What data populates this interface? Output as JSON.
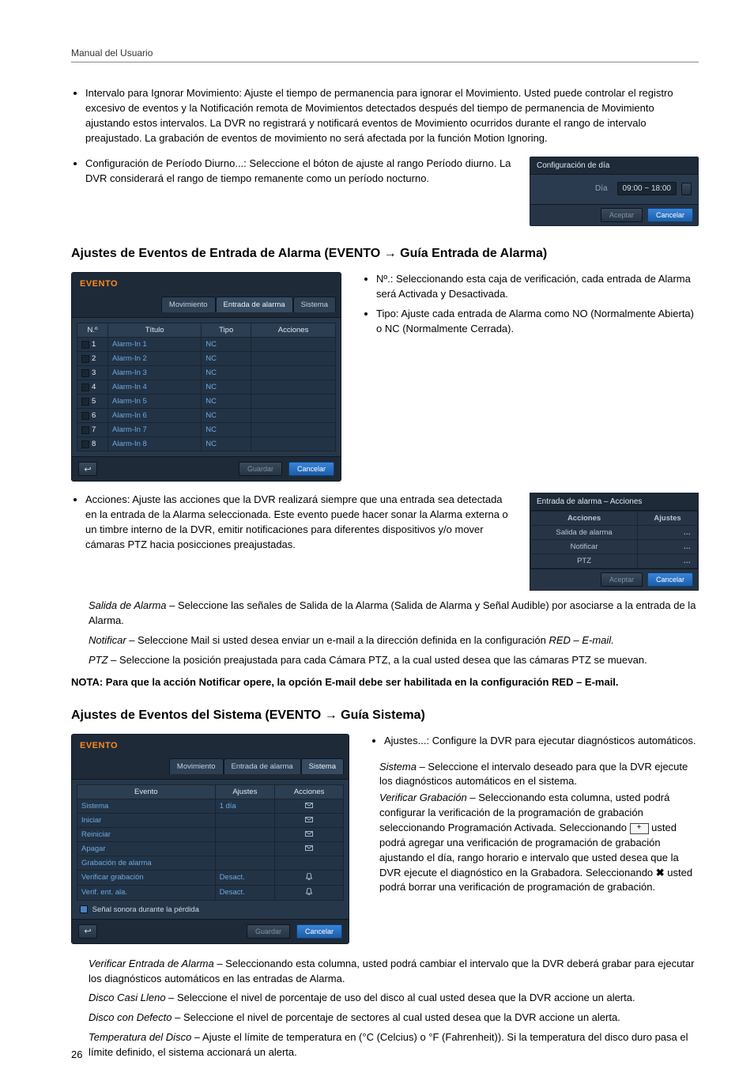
{
  "header": {
    "title": "Manual del Usuario"
  },
  "page_number": "26",
  "bullets_top": [
    "Intervalo para Ignorar Movimiento: Ajuste el tiempo de permanencia para ignorar el Movimiento. Usted puede controlar el registro excesivo de eventos y la Notificación remota de Movimientos detectados después del tiempo de permanencia de Movimiento ajustando estos intervalos. La DVR no registrará y notificará eventos de Movimiento ocurridos durante el rango de intervalo preajustado. La grabación de eventos de movimiento no será afectada por la función Motion Ignoring.",
    "Configuración de Período Diurno...: Seleccione el bóton de ajuste al rango Período diurno. La DVR considerará el rango de tiempo remanente como un período nocturno."
  ],
  "day_panel": {
    "title": "Configuración de día",
    "label": "Día",
    "time": "09:00 ~ 18:00",
    "accept": "Aceptar",
    "cancel": "Cancelar"
  },
  "sec1": {
    "heading": "Ajustes de Eventos de Entrada de Alarma (EVENTO → Guía Entrada de Alarma)",
    "side_bullets": [
      "Nº.: Seleccionando esta caja de verificación, cada entrada de Alarma será Activada y Desactivada.",
      "Tipo: Ajuste cada entrada de Alarma como NO (Normalmente Abierta) o NC (Normalmente Cerrada)."
    ],
    "ui": {
      "brand": "EVENTO",
      "tabs": [
        "Movimiento",
        "Entrada de alarma",
        "Sistema"
      ],
      "active_tab_index": 1,
      "cols": [
        "N.º",
        "Título",
        "Tipo",
        "Acciones"
      ],
      "rows": [
        {
          "n": "1",
          "title": "Alarm-In 1",
          "type": "NC"
        },
        {
          "n": "2",
          "title": "Alarm-In 2",
          "type": "NC"
        },
        {
          "n": "3",
          "title": "Alarm-In 3",
          "type": "NC"
        },
        {
          "n": "4",
          "title": "Alarm-In 4",
          "type": "NC"
        },
        {
          "n": "5",
          "title": "Alarm-In 5",
          "type": "NC"
        },
        {
          "n": "6",
          "title": "Alarm-In 6",
          "type": "NC"
        },
        {
          "n": "7",
          "title": "Alarm-In 7",
          "type": "NC"
        },
        {
          "n": "8",
          "title": "Alarm-In 8",
          "type": "NC"
        }
      ],
      "save": "Guardar",
      "cancel": "Cancelar"
    }
  },
  "acciones_text": "Acciones: Ajuste las acciones que la DVR realizará siempre que una entrada sea detectada en la entrada de la Alarma seleccionada. Este evento puede hacer sonar la Alarma externa o un timbre interno de la DVR, emitir notificaciones para diferentes dispositivos y/o mover cámaras PTZ hacia posicciones preajustadas.",
  "acciones_panel": {
    "title": "Entrada de alarma – Acciones",
    "cols": [
      "Acciones",
      "Ajustes"
    ],
    "rows": [
      "Salida de alarma",
      "Notificar",
      "PTZ"
    ],
    "accept": "Aceptar",
    "cancel": "Cancelar"
  },
  "sub_actions": {
    "s1_lead": "Salida de Alarma",
    "s1_rest": " – Seleccione las señales de Salida de la Alarma (Salida de Alarma y Señal Audible) por asociarse a la entrada de la Alarma.",
    "s2_lead": "Notificar",
    "s2_rest": " – Seleccione Mail si usted desea enviar un e-mail a la dirección definida en la configuración ",
    "s2_tail": "RED – E-mail.",
    "s3_lead": "PTZ",
    "s3_rest": " – Seleccione la posición preajustada para cada Cámara PTZ, a la cual usted desea que las cámaras PTZ se muevan."
  },
  "nota1": "NOTA: Para que la acción Notificar opere, la opción E-mail debe ser habilitada en la configuración RED – E-mail.",
  "sec2": {
    "heading": "Ajustes de Eventos del Sistema (EVENTO → Guía Sistema)",
    "ui": {
      "brand": "EVENTO",
      "tabs": [
        "Movimiento",
        "Entrada de alarma",
        "Sistema"
      ],
      "active_tab_index": 2,
      "cols": [
        "Evento",
        "Ajustes",
        "Acciones"
      ],
      "rows": [
        {
          "event": "Sistema",
          "ajustes": "1 día",
          "icon": "mail"
        },
        {
          "event": "Iniciar",
          "ajustes": "",
          "icon": "mail"
        },
        {
          "event": "Reiniciar",
          "ajustes": "",
          "icon": "mail"
        },
        {
          "event": "Apagar",
          "ajustes": "",
          "icon": "mail"
        },
        {
          "event": "Grabación de alarma",
          "ajustes": "",
          "icon": ""
        },
        {
          "event": "Verificar grabación",
          "ajustes": "Desact.",
          "icon": "bell"
        },
        {
          "event": "Verif. ent. ala.",
          "ajustes": "Desact.",
          "icon": "bell"
        }
      ],
      "checkbox_label": "Señal sonora durante la pérdida",
      "save": "Guardar",
      "cancel": "Cancelar"
    },
    "side": {
      "bullet": "Ajustes...: Configure la DVR para ejecutar diagnósticos automáticos.",
      "s1_lead": "Sistema",
      "s1_rest": " – Seleccione el intervalo deseado para que la DVR ejecute los diagnósticos automáticos en el sistema.",
      "s2_lead": "Verificar Grabación",
      "s2_rest_a": " – Seleccionando esta columna, usted podrá configurar la verificación de la programación de grabación seleccionando Programación Activada. Seleccionando ",
      "s2_rest_b": " usted podrá agregar una verificación de programación de grabación ajustando el día, rango horario e intervalo que usted desea que la DVR ejecute el diagnóstico en la Grabadora. Seleccionando ",
      "s2_rest_c": " usted podrá borrar una verificación de programación de grabación."
    },
    "bottom": {
      "b1_lead": "Verificar Entrada de Alarma",
      "b1_rest": " – Seleccionando esta columna, usted podrá cambiar el intervalo que la DVR deberá grabar para ejecutar los diagnósticos automáticos en las entradas de Alarma.",
      "b2_lead": "Disco Casi Lleno",
      "b2_rest": " – Seleccione el nivel de porcentaje de uso del disco al cual usted desea que la DVR accione un alerta.",
      "b3_lead": "Disco con Defecto",
      "b3_rest": " – Seleccione el nivel de porcentaje de sectores al cual usted desea que la DVR accione un alerta.",
      "b4_lead": "Temperatura del Disco",
      "b4_rest": " – Ajuste el límite de temperatura en (°C (Celcius) o °F (Fahrenheit)). Si la temperatura del disco duro pasa el límite definido, el sistema accionará un alerta."
    }
  }
}
